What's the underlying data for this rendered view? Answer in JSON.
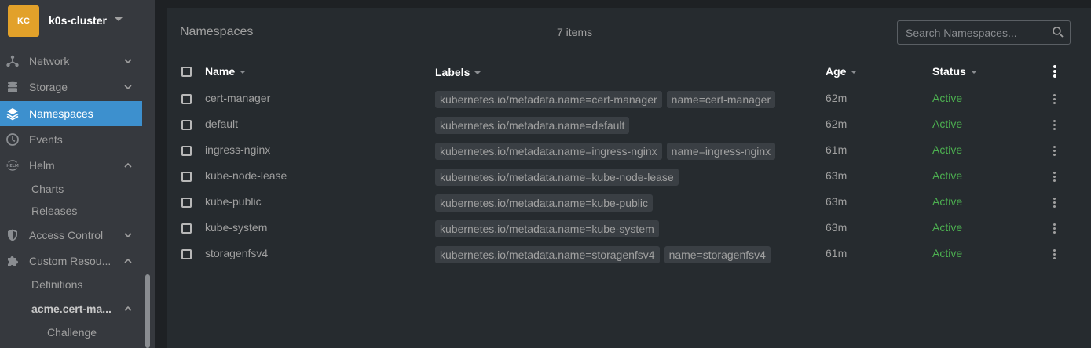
{
  "cluster": {
    "initials": "KC",
    "name": "k0s-cluster"
  },
  "sidebar": {
    "items": [
      {
        "label": "Network",
        "icon": "network-icon"
      },
      {
        "label": "Storage",
        "icon": "storage-icon"
      },
      {
        "label": "Namespaces",
        "icon": "namespaces-icon",
        "active": true
      },
      {
        "label": "Events",
        "icon": "clock-icon"
      },
      {
        "label": "Helm",
        "icon": "helm-icon"
      },
      {
        "label": "Access Control",
        "icon": "shield-icon"
      },
      {
        "label": "Custom Resou...",
        "icon": "puzzle-icon"
      }
    ],
    "helm_sub": [
      "Charts",
      "Releases"
    ],
    "custom_sub": {
      "definitions": "Definitions",
      "group": "acme.cert-ma...",
      "challenge": "Challenge"
    },
    "helm_icon_text": "HELM"
  },
  "panel": {
    "title": "Namespaces",
    "count": "7 items",
    "search_placeholder": "Search Namespaces..."
  },
  "columns": {
    "name": "Name",
    "labels": "Labels",
    "age": "Age",
    "status": "Status"
  },
  "rows": [
    {
      "name": "cert-manager",
      "labels": [
        "kubernetes.io/metadata.name=cert-manager",
        "name=cert-manager"
      ],
      "age": "62m",
      "status": "Active"
    },
    {
      "name": "default",
      "labels": [
        "kubernetes.io/metadata.name=default"
      ],
      "age": "62m",
      "status": "Active"
    },
    {
      "name": "ingress-nginx",
      "labels": [
        "kubernetes.io/metadata.name=ingress-nginx",
        "name=ingress-nginx"
      ],
      "age": "61m",
      "status": "Active"
    },
    {
      "name": "kube-node-lease",
      "labels": [
        "kubernetes.io/metadata.name=kube-node-lease"
      ],
      "age": "63m",
      "status": "Active"
    },
    {
      "name": "kube-public",
      "labels": [
        "kubernetes.io/metadata.name=kube-public"
      ],
      "age": "63m",
      "status": "Active"
    },
    {
      "name": "kube-system",
      "labels": [
        "kubernetes.io/metadata.name=kube-system"
      ],
      "age": "63m",
      "status": "Active"
    },
    {
      "name": "storagenfsv4",
      "labels": [
        "kubernetes.io/metadata.name=storagenfsv4",
        "name=storagenfsv4"
      ],
      "age": "61m",
      "status": "Active"
    }
  ],
  "colors": {
    "accent": "#3d90ce",
    "avatar": "#e2a12a",
    "active_status": "#4caf50"
  }
}
